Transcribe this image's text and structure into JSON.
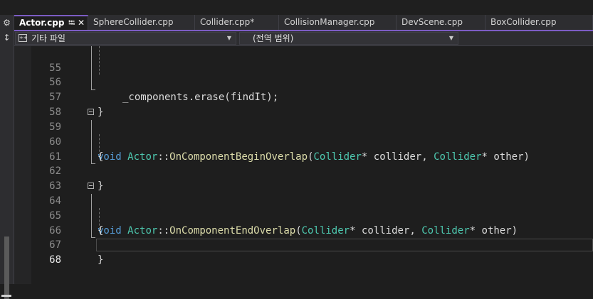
{
  "tabs": [
    {
      "label": "Actor.cpp",
      "active": true,
      "icons": "⭾ ✕"
    },
    {
      "label": "SphereCollider.cpp"
    },
    {
      "label": "Collider.cpp*"
    },
    {
      "label": "CollisionManager.cpp"
    },
    {
      "label": "DevScene.cpp"
    },
    {
      "label": "BoxCollider.cpp"
    }
  ],
  "navbar": {
    "project_icon": "++",
    "project": "기타 파일",
    "scope": "(전역 범위)"
  },
  "side_icons": [
    "gear-icon",
    "pin-icon"
  ],
  "accent_color": "#7c5cc4",
  "lines": [
    {
      "num": "55",
      "tokens": []
    },
    {
      "num": "56",
      "tokens": [
        {
          "t": "_components.erase(findIt);",
          "c": "plain"
        }
      ]
    },
    {
      "num": "57",
      "tokens": [
        {
          "t": "}",
          "c": "plain"
        }
      ]
    },
    {
      "num": "58",
      "tokens": []
    },
    {
      "num": "59",
      "tokens": [
        {
          "t": "void",
          "c": "kw"
        },
        {
          "t": " ",
          "c": "plain"
        },
        {
          "t": "Actor",
          "c": "ty"
        },
        {
          "t": "::",
          "c": "plain"
        },
        {
          "t": "OnComponentBeginOverlap",
          "c": "fn"
        },
        {
          "t": "(",
          "c": "plain"
        },
        {
          "t": "Collider",
          "c": "ty"
        },
        {
          "t": "* collider, ",
          "c": "plain"
        },
        {
          "t": "Collider",
          "c": "ty"
        },
        {
          "t": "* other)",
          "c": "plain"
        }
      ]
    },
    {
      "num": "60",
      "tokens": [
        {
          "t": "{",
          "c": "plain"
        }
      ]
    },
    {
      "num": "61",
      "tokens": []
    },
    {
      "num": "62",
      "tokens": [
        {
          "t": "}",
          "c": "plain"
        }
      ]
    },
    {
      "num": "63",
      "tokens": []
    },
    {
      "num": "64",
      "tokens": [
        {
          "t": "void",
          "c": "kw"
        },
        {
          "t": " ",
          "c": "plain"
        },
        {
          "t": "Actor",
          "c": "ty"
        },
        {
          "t": "::",
          "c": "plain"
        },
        {
          "t": "OnComponentEndOverlap",
          "c": "fn"
        },
        {
          "t": "(",
          "c": "plain"
        },
        {
          "t": "Collider",
          "c": "ty"
        },
        {
          "t": "* collider, ",
          "c": "plain"
        },
        {
          "t": "Collider",
          "c": "ty"
        },
        {
          "t": "* other)",
          "c": "plain"
        }
      ]
    },
    {
      "num": "65",
      "tokens": [
        {
          "t": "{",
          "c": "plain"
        }
      ]
    },
    {
      "num": "66",
      "tokens": []
    },
    {
      "num": "67",
      "tokens": [
        {
          "t": "}",
          "c": "plain"
        }
      ]
    },
    {
      "num": "68",
      "tokens": [],
      "current": true
    }
  ]
}
